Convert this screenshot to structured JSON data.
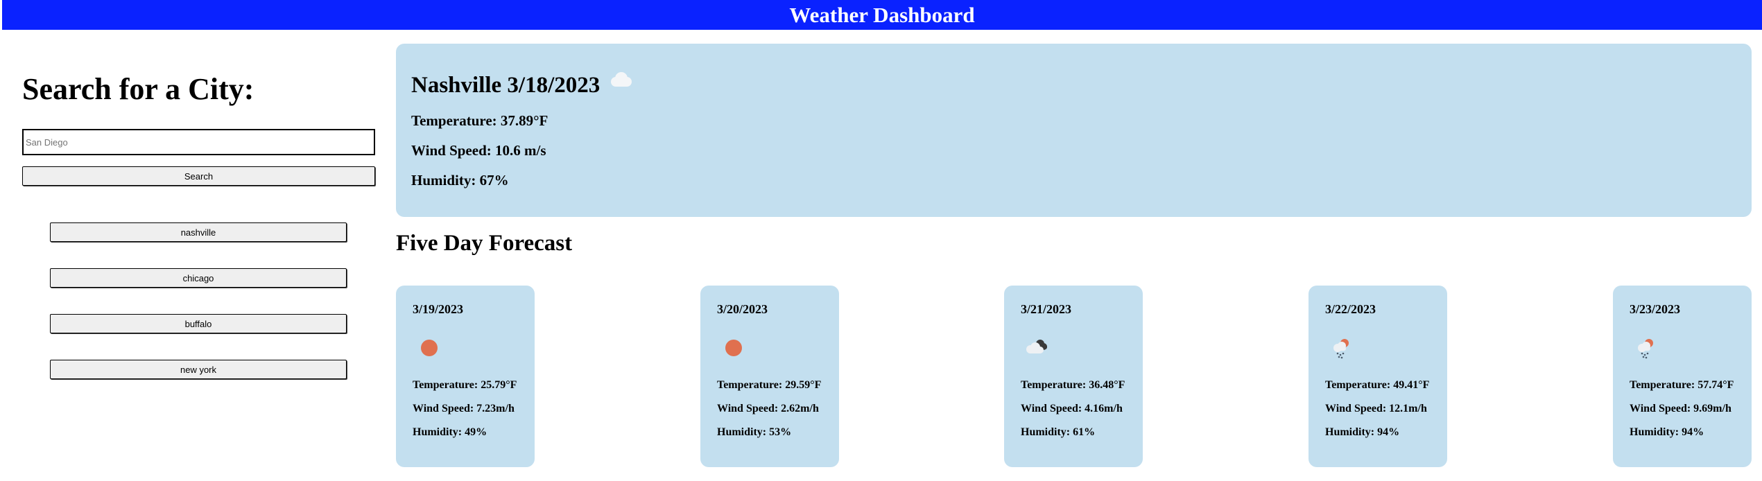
{
  "header": {
    "title": "Weather Dashboard"
  },
  "sidebar": {
    "heading": "Search for a City:",
    "search": {
      "value": "",
      "placeholder": "San Diego"
    },
    "search_button": "Search",
    "history": [
      "nashville",
      "chicago",
      "buffalo",
      "new york"
    ]
  },
  "current": {
    "title": "Nashville 3/18/2023",
    "icon": "cloud-icon",
    "temperature": "Temperature: 37.89°F",
    "wind": "Wind Speed: 10.6 m/s",
    "humidity": "Humidity: 67%"
  },
  "forecast": {
    "title": "Five Day Forecast",
    "days": [
      {
        "date": "3/19/2023",
        "icon": "sun-icon",
        "temperature": "Temperature: 25.79°F",
        "wind": "Wind Speed: 7.23m/h",
        "humidity": "Humidity: 49%"
      },
      {
        "date": "3/20/2023",
        "icon": "sun-icon",
        "temperature": "Temperature: 29.59°F",
        "wind": "Wind Speed: 2.62m/h",
        "humidity": "Humidity: 53%"
      },
      {
        "date": "3/21/2023",
        "icon": "broken-clouds-icon",
        "temperature": "Temperature: 36.48°F",
        "wind": "Wind Speed: 4.16m/h",
        "humidity": "Humidity: 61%"
      },
      {
        "date": "3/22/2023",
        "icon": "sun-rain-icon",
        "temperature": "Temperature: 49.41°F",
        "wind": "Wind Speed: 12.1m/h",
        "humidity": "Humidity: 94%"
      },
      {
        "date": "3/23/2023",
        "icon": "sun-rain-icon",
        "temperature": "Temperature: 57.74°F",
        "wind": "Wind Speed: 9.69m/h",
        "humidity": "Humidity: 94%"
      }
    ]
  },
  "colors": {
    "header_bg": "#0a22ff",
    "card_bg": "#c3dfef",
    "sun": "#e0704f"
  }
}
